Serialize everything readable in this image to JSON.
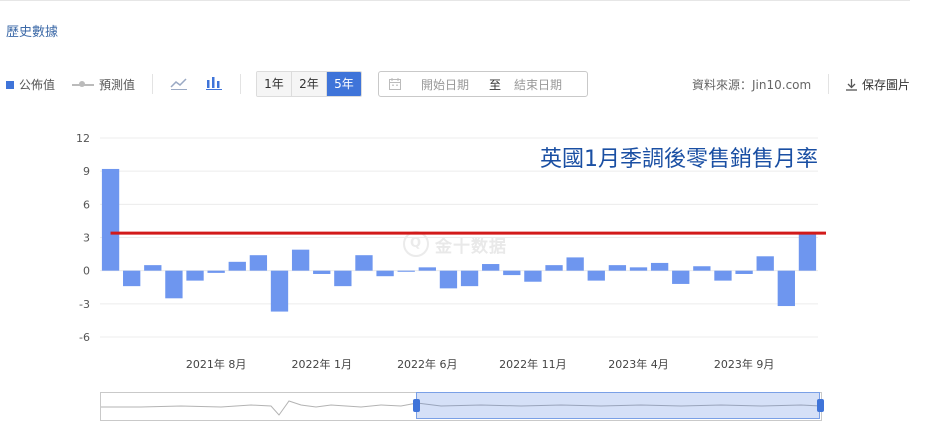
{
  "section_title": "歷史數據",
  "toolbar": {
    "legend_published": "公佈值",
    "legend_forecast": "預測值",
    "line_chart_icon": "line-chart-icon",
    "bar_chart_icon": "bar-chart-icon",
    "ranges": [
      "1年",
      "2年",
      "5年"
    ],
    "active_range": "5年",
    "date_start_placeholder": "開始日期",
    "date_separator": "至",
    "date_end_placeholder": "結束日期",
    "source": "資料來源：Jin10.com",
    "save_label": "保存圖片"
  },
  "watermark": "金十数据",
  "chart_data": {
    "type": "bar",
    "title": "英國1月季調後零售銷售月率",
    "ylim": [
      -6,
      12
    ],
    "y_ticks": [
      12,
      9,
      6,
      3,
      0,
      -3,
      -6
    ],
    "x_tick_labels": [
      {
        "index": 5,
        "label": "2021年 8月"
      },
      {
        "index": 10,
        "label": "2022年 1月"
      },
      {
        "index": 15,
        "label": "2022年 6月"
      },
      {
        "index": 20,
        "label": "2022年 11月"
      },
      {
        "index": 25,
        "label": "2023年 4月"
      },
      {
        "index": 30,
        "label": "2023年 9月"
      }
    ],
    "series": [
      {
        "values": [
          9.2,
          -1.4,
          0.5,
          -2.5,
          -0.9,
          -0.2,
          0.8,
          1.4,
          -3.7,
          1.9,
          -0.3,
          -1.4,
          1.4,
          -0.5,
          -0.1,
          0.3,
          -1.6,
          -1.4,
          0.6,
          -0.4,
          -1.0,
          0.5,
          1.2,
          -0.9,
          0.5,
          0.3,
          0.7,
          -1.2,
          0.4,
          -0.9,
          -0.3,
          1.3,
          -3.2,
          3.4
        ],
        "color": "#6e96ef"
      }
    ],
    "reference_line": {
      "value": 3.4,
      "color": "#d21a1a"
    },
    "grid": true
  },
  "navigator": {
    "selected_fraction_start": 0.44,
    "selected_fraction_end": 1.0
  }
}
